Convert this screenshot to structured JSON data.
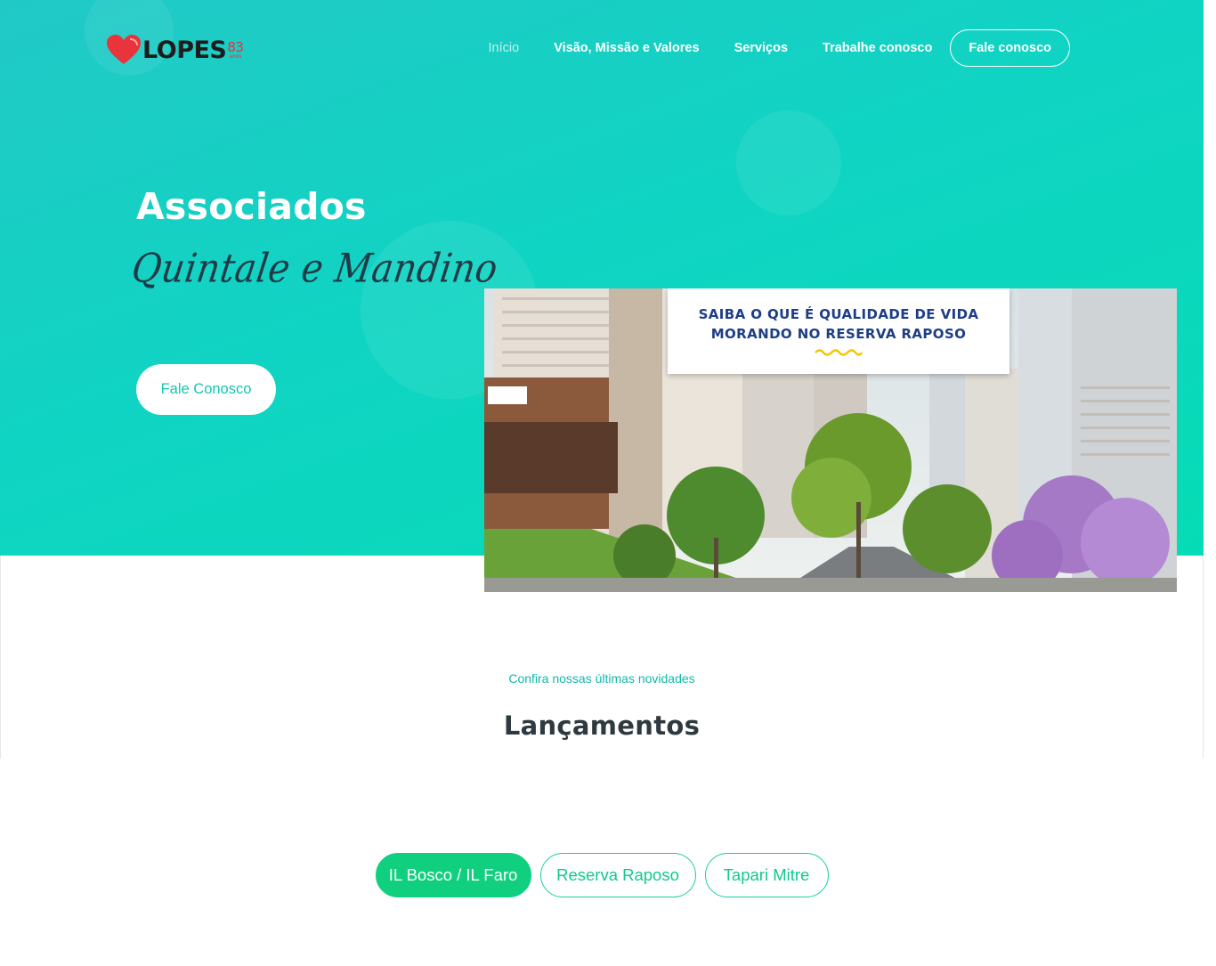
{
  "brand": {
    "name": "LOPES",
    "years": "83",
    "years_label": "anos",
    "accent": "#e8343a"
  },
  "nav": {
    "items": [
      {
        "label": "Início",
        "active": true
      },
      {
        "label": "Visão, Missão e Valores",
        "active": false
      },
      {
        "label": "Serviços",
        "active": false
      },
      {
        "label": "Trabalhe conosco",
        "active": false
      }
    ],
    "cta": "Fale conosco"
  },
  "hero": {
    "title": "Associados",
    "subtitle": "Quintale e Mandino",
    "button": "Fale Conosco",
    "gradient_start": "#21c9c6",
    "gradient_end": "#05dcb5"
  },
  "banner": {
    "line1": "SAIBA O QUE É QUALIDADE DE VIDA",
    "line2": "MORANDO NO RESERVA RAPOSO",
    "image": "apartment-towers-street-trees"
  },
  "section": {
    "kicker": "Confira nossas últimas novidades",
    "title": "Lançamentos"
  },
  "tabs": [
    {
      "label": "IL Bosco / IL Faro",
      "active": true
    },
    {
      "label": "Reserva Raposo",
      "active": false
    },
    {
      "label": "Tapari Mitre",
      "active": false
    }
  ],
  "colors": {
    "primary": "#13c7b4",
    "tab_active": "#10d07f",
    "banner_text": "#1d3e86"
  }
}
